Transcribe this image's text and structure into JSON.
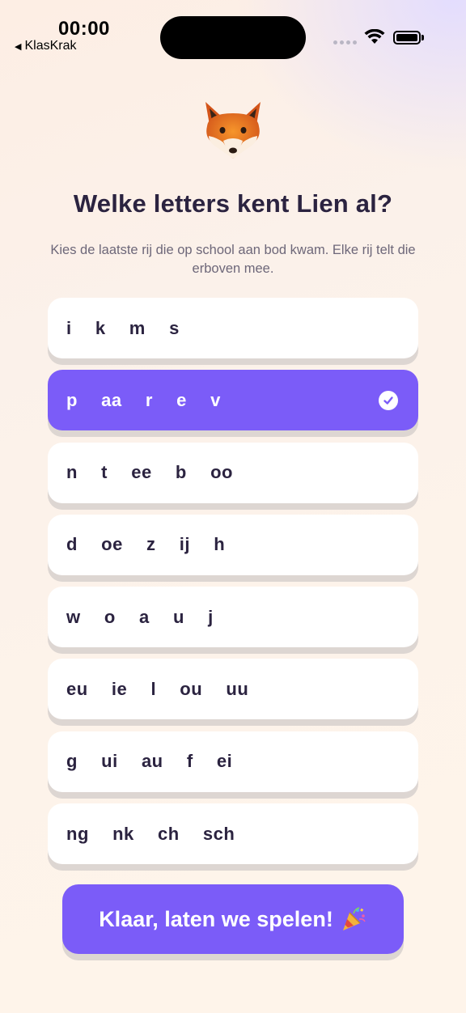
{
  "status_bar": {
    "time": "00:00",
    "back_app": "KlasKrak"
  },
  "mascot": {
    "icon": "fox-icon"
  },
  "header": {
    "title": "Welke letters kent Lien al?",
    "subtitle": "Kies de laatste rij die op school aan bod kwam. Elke rij telt die erboven mee."
  },
  "rows": [
    {
      "letters": "i  k  m  s",
      "selected": false
    },
    {
      "letters": "p  aa  r  e  v",
      "selected": true
    },
    {
      "letters": "n  t  ee  b  oo",
      "selected": false
    },
    {
      "letters": "d  oe  z  ij  h",
      "selected": false
    },
    {
      "letters": "w  o  a  u  j",
      "selected": false
    },
    {
      "letters": "eu  ie  l  ou  uu",
      "selected": false
    },
    {
      "letters": "g  ui  au  f  ei",
      "selected": false
    },
    {
      "letters": "ng  nk  ch  sch",
      "selected": false
    }
  ],
  "cta": {
    "label": "Klaar, laten we spelen!",
    "icon": "party-popper-icon"
  },
  "colors": {
    "accent": "#7b5cf8",
    "text": "#2b2340",
    "card": "#ffffff"
  }
}
